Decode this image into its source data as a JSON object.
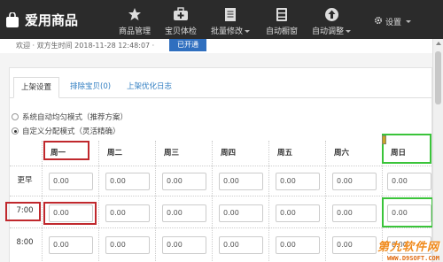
{
  "app": {
    "brand": "爱用商品"
  },
  "nav": [
    {
      "label": "商品管理",
      "icon": "star-icon"
    },
    {
      "label": "宝贝体检",
      "icon": "medkit-icon"
    },
    {
      "label": "批量修改",
      "icon": "document-icon",
      "has_caret": true
    },
    {
      "label": "自动橱窗",
      "icon": "server-icon"
    },
    {
      "label": "自动调整",
      "icon": "upload-circle-icon",
      "has_caret": true
    }
  ],
  "settings_label": "设置",
  "notice": {
    "text": "欢迎 · 双方生时间 2018-11-28 12:48:07 · ",
    "button": "已开通"
  },
  "tabs": [
    {
      "label": "上架设置",
      "active": true
    },
    {
      "label": "排除宝贝(0)",
      "active": false
    },
    {
      "label": "上架优化日志",
      "active": false
    }
  ],
  "modes": [
    {
      "label": "系统自动均匀模式（推荐方案）",
      "checked": false
    },
    {
      "label": "自定义分配模式（灵活精确）",
      "checked": true
    }
  ],
  "schedule": {
    "days": [
      "周一",
      "周二",
      "周三",
      "周四",
      "周五",
      "周六",
      "周日"
    ],
    "rows": [
      {
        "label": "更早",
        "values": [
          "0.00",
          "0.00",
          "0.00",
          "0.00",
          "0.00",
          "0.00",
          "0.00"
        ]
      },
      {
        "label": "7:00",
        "values": [
          "0.00",
          "0.00",
          "0.00",
          "0.00",
          "0.00",
          "0.00",
          "0.00"
        ]
      },
      {
        "label": "8:00",
        "values": [
          "0.00",
          "0.00",
          "0.00",
          "0.00",
          "0.00",
          "0.00",
          "0.00"
        ]
      }
    ]
  },
  "watermark": {
    "title": "第九软件网",
    "url": "WWW.D9SOFT.COM"
  },
  "colors": {
    "highlight_red": "#c0282d",
    "highlight_green": "#3ac43a",
    "nav_bg": "#2b2b2b",
    "link": "#2f7dc1"
  }
}
